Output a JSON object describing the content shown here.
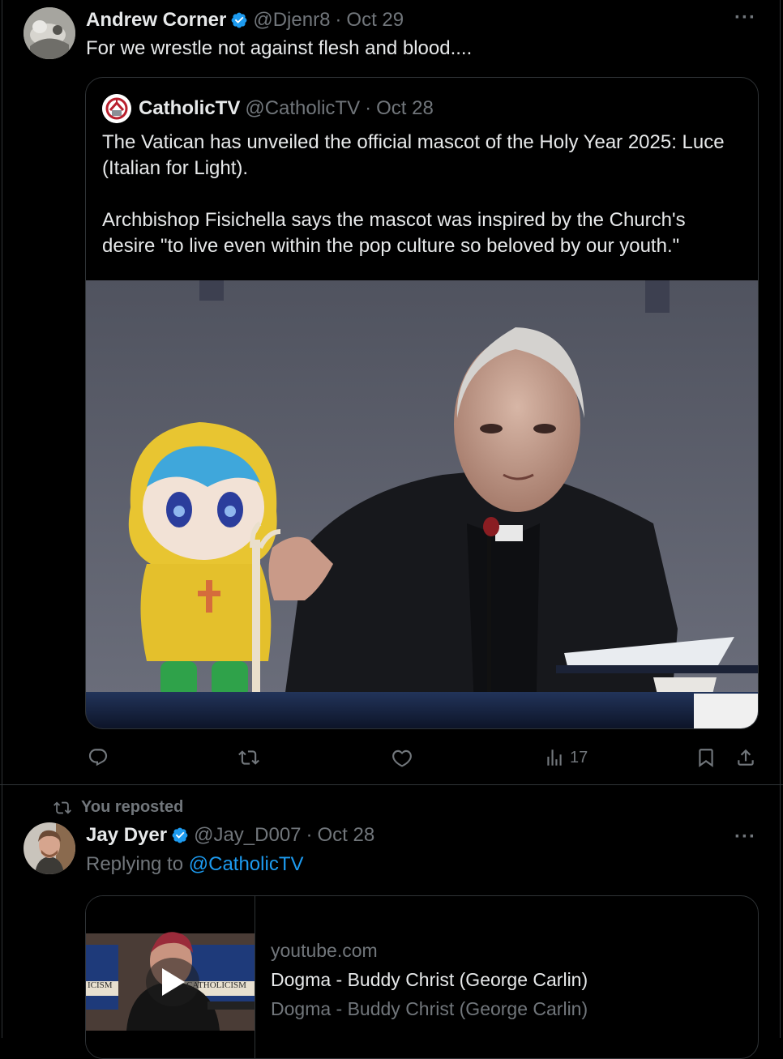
{
  "colors": {
    "background": "#000000",
    "text": "#e7e9ea",
    "muted": "#71767b",
    "accent": "#1d9bf0",
    "border": "#2f3336"
  },
  "tweet1": {
    "name": "Andrew Corner",
    "handle": "@Djenr8",
    "separator": "·",
    "date": "Oct 29",
    "text": "For we wrestle not against flesh and blood....",
    "more": "···",
    "verified_icon": "verified-badge-icon",
    "quote": {
      "name": "CatholicTV",
      "handle": "@CatholicTV",
      "separator": "·",
      "date": "Oct 28",
      "para1": "The Vatican has unveiled the official mascot of the Holy Year 2025: Luce (Italian for Light).",
      "para2": "Archbishop Fisichella says the mascot was inspired by the Church's desire \"to live even within the pop culture so beloved by our youth.\""
    },
    "actions": {
      "reply_icon": "reply-icon",
      "repost_icon": "repost-icon",
      "like_icon": "like-icon",
      "views_icon": "views-icon",
      "views_count": "17",
      "bookmark_icon": "bookmark-icon",
      "share_icon": "share-icon"
    }
  },
  "tweet2": {
    "repost_label": "You reposted",
    "name": "Jay Dyer",
    "handle": "@Jay_D007",
    "separator": "·",
    "date": "Oct 28",
    "replying_prefix": "Replying to ",
    "replying_to": "@CatholicTV",
    "more": "···",
    "card": {
      "domain": "youtube.com",
      "title": "Dogma - Buddy Christ (George Carlin)",
      "description": "Dogma - Buddy Christ (George Carlin)",
      "thumb_left_text": "ICISM",
      "thumb_right_text": "CATHOLICISM"
    }
  }
}
